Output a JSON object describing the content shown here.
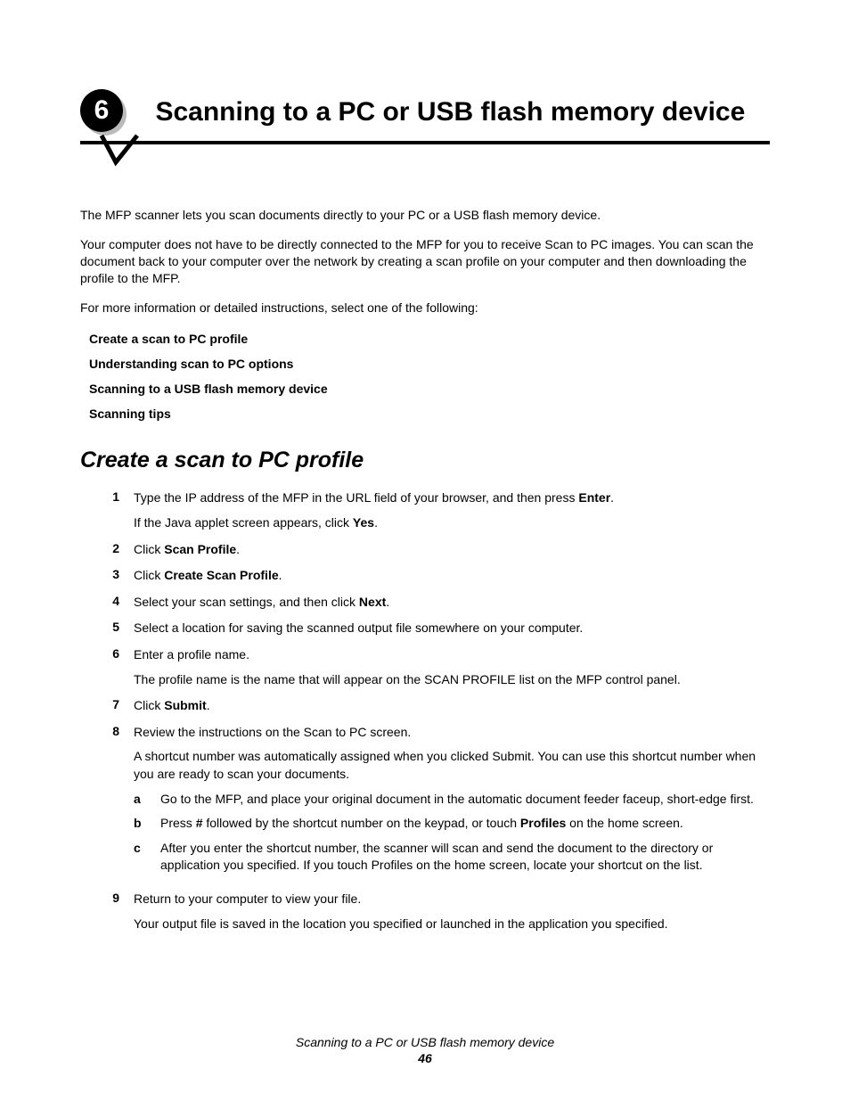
{
  "chapter": {
    "number": "6",
    "title": "Scanning to a PC or USB flash memory device"
  },
  "intro": {
    "p1": "The MFP scanner lets you scan documents directly to your PC or a USB flash memory device.",
    "p2": "Your computer does not have to be directly connected to the MFP for you to receive Scan to PC images. You can scan the document back to your computer over the network by creating a scan profile on your computer and then downloading the profile to the MFP.",
    "p3": "For more information or detailed instructions, select one of the following:"
  },
  "toc": [
    "Create a scan to PC profile",
    "Understanding scan to PC options",
    "Scanning to a USB flash memory device",
    "Scanning tips"
  ],
  "section": {
    "heading": "Create a scan to PC profile"
  },
  "steps": {
    "s1": {
      "num": "1",
      "line1_a": "Type the IP address of the MFP in the URL field of your browser, and then press ",
      "line1_b": "Enter",
      "line1_c": ".",
      "line2_a": "If the Java applet screen appears, click ",
      "line2_b": "Yes",
      "line2_c": "."
    },
    "s2": {
      "num": "2",
      "a": "Click ",
      "b": "Scan Profile",
      "c": "."
    },
    "s3": {
      "num": "3",
      "a": "Click ",
      "b": "Create Scan Profile",
      "c": "."
    },
    "s4": {
      "num": "4",
      "a": "Select your scan settings, and then click ",
      "b": "Next",
      "c": "."
    },
    "s5": {
      "num": "5",
      "text": "Select a location for saving the scanned output file somewhere on your computer."
    },
    "s6": {
      "num": "6",
      "line1": "Enter a profile name.",
      "line2": "The profile name is the name that will appear on the SCAN PROFILE list on the MFP control panel."
    },
    "s7": {
      "num": "7",
      "a": "Click ",
      "b": "Submit",
      "c": "."
    },
    "s8": {
      "num": "8",
      "line1": "Review the instructions on the Scan to PC screen.",
      "line2": "A shortcut number was automatically assigned when you clicked Submit. You can use this shortcut number when you are ready to scan your documents.",
      "sub_a": {
        "letter": "a",
        "text": "Go to the MFP, and place your original document in the automatic document feeder faceup, short-edge first."
      },
      "sub_b": {
        "letter": "b",
        "t1": "Press ",
        "t2": "#",
        "t3": " followed by the shortcut number on the keypad, or touch ",
        "t4": "Profiles",
        "t5": " on the home screen."
      },
      "sub_c": {
        "letter": "c",
        "text": "After you enter the shortcut number, the scanner will scan and send the document to the directory or application you specified. If you touch Profiles on the home screen, locate your shortcut on the list."
      }
    },
    "s9": {
      "num": "9",
      "line1": "Return to your computer to view your file.",
      "line2": "Your output file is saved in the location you specified or launched in the application you specified."
    }
  },
  "footer": {
    "title": "Scanning to a PC or USB flash memory device",
    "page": "46"
  }
}
